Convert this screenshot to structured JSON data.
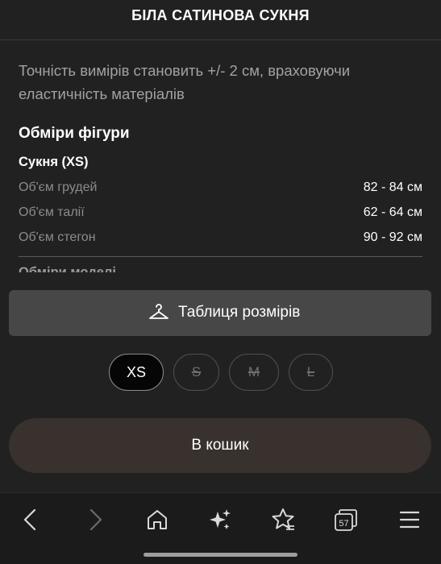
{
  "header": {
    "title": "БІЛА САТИНОВА СУКНЯ"
  },
  "note": "Точність вимірів становить +/- 2 см, враховуючи еластичність матеріалів",
  "measurements": {
    "section_title": "Обміри фігури",
    "dress_title": "Сукня (XS)",
    "rows": [
      {
        "label": "Об'єм грудей",
        "value": "82 - 84 см"
      },
      {
        "label": "Об'єм талії",
        "value": "62 - 64 см"
      },
      {
        "label": "Об'єм стегон",
        "value": "90 - 92 см"
      }
    ],
    "truncated_next": "Обміри моделі"
  },
  "size_table_button": {
    "label": "Таблиця розмірів",
    "icon": "hanger-icon"
  },
  "sizes": [
    {
      "label": "XS",
      "selected": true,
      "available": true
    },
    {
      "label": "S",
      "selected": false,
      "available": false
    },
    {
      "label": "M",
      "selected": false,
      "available": false
    },
    {
      "label": "L",
      "selected": false,
      "available": false
    }
  ],
  "cart_button": {
    "label": "В кошик"
  },
  "navbar": {
    "icons": [
      "back-arrow-icon",
      "forward-arrow-icon",
      "home-icon",
      "sparkle-icon",
      "bookmark-star-icon",
      "tabs-icon",
      "menu-icon"
    ],
    "tabs_count": "57"
  },
  "colors": {
    "background": "#212121",
    "button_gray": "#474747",
    "cart_button": "#38312d",
    "selected_size": "#060606"
  }
}
